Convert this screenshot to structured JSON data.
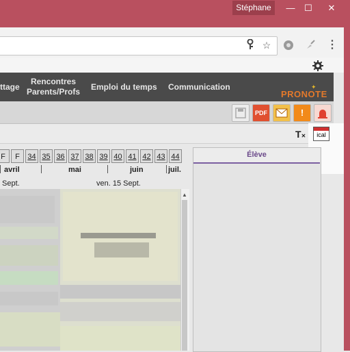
{
  "window": {
    "user": "Stéphane",
    "minimize": "—",
    "maximize": "☐",
    "close": "✕"
  },
  "browser": {
    "key_icon": "key-icon",
    "star_icon": "star-icon",
    "extension_icon": "gear-extension-icon",
    "brush_icon": "brush-icon",
    "menu_icon": "⋮"
  },
  "nav": {
    "items": [
      "ttage",
      "Rencontres\nParents/Profs",
      "Emploi du temps",
      "Communication"
    ],
    "logo": "PRONOTE"
  },
  "toolbar": {
    "pdf": "PDF",
    "alert": "!",
    "ical": "ical"
  },
  "weeks": [
    "F",
    "F",
    "34",
    "35",
    "36",
    "37",
    "38",
    "39",
    "40",
    "41",
    "42",
    "43",
    "44"
  ],
  "months": [
    "avril",
    "mai",
    "juin",
    "juil."
  ],
  "days": [
    "Sept.",
    "ven. 15 Sept."
  ],
  "eleve": {
    "title": "Élève"
  }
}
